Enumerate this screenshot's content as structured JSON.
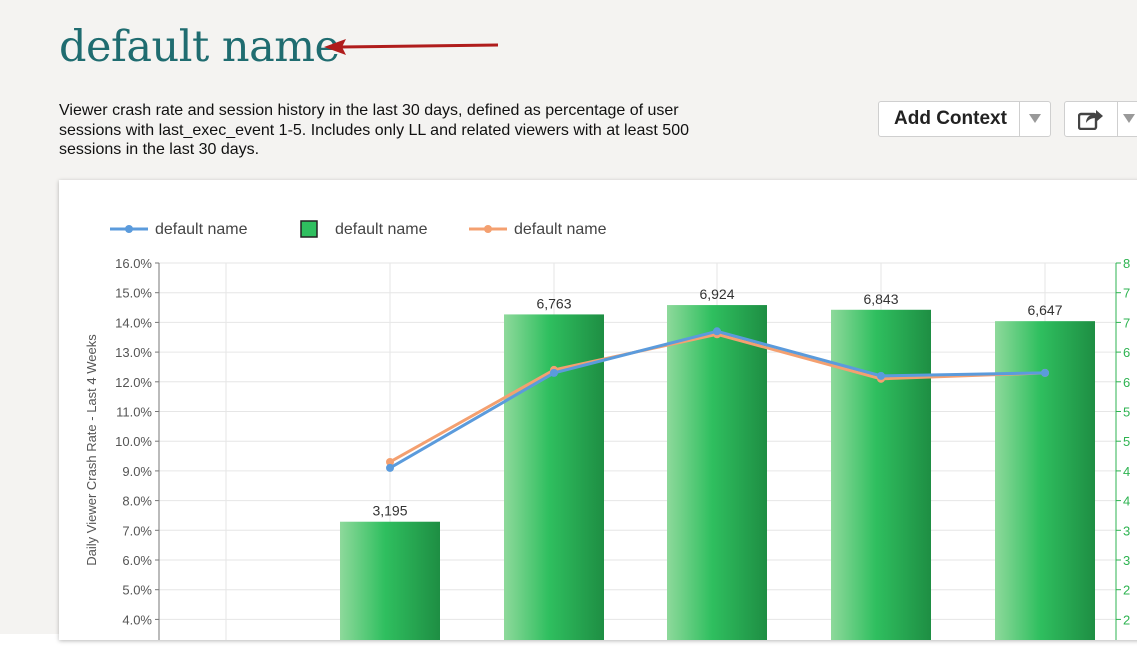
{
  "page": {
    "title": "default name",
    "description": "Viewer crash rate and session history in the last 30 days, defined as percentage of user sessions with last_exec_event 1-5. Includes only LL and related viewers with at least 500 sessions in the last 30 days."
  },
  "toolbar": {
    "add_context_label": "Add Context"
  },
  "icons": {
    "caret": "caret-down-icon",
    "share": "share-icon",
    "annotation": "red-arrow-icon"
  },
  "colors": {
    "title": "#1f6c70",
    "bars": "#2fbf5f",
    "line_blue": "#5b9bdc",
    "line_orange": "#f4a070",
    "right_axis": "#2db350",
    "annotation_arrow": "#b01c1c"
  },
  "chart_data": {
    "type": "bar",
    "legend": [
      {
        "name": "default name",
        "kind": "line",
        "color": "#5b9bdc"
      },
      {
        "name": "default name",
        "kind": "bar",
        "color": "#2fbf5f"
      },
      {
        "name": "default name",
        "kind": "line",
        "color": "#f4a070"
      }
    ],
    "ylabel": "Daily Viewer Crash Rate - Last 4 Weeks",
    "ylim": [
      4,
      16
    ],
    "yticks": [
      "16.0%",
      "15.0%",
      "14.0%",
      "13.0%",
      "12.0%",
      "11.0%",
      "10.0%",
      "9.0%",
      "8.0%",
      "7.0%",
      "6.0%",
      "5.0%",
      "4.0%"
    ],
    "right_ticks": [
      "8",
      "7",
      "7",
      "6",
      "6",
      "5",
      "5",
      "4",
      "4",
      "3",
      "3",
      "2",
      "2"
    ],
    "bars": {
      "name": "default name",
      "values": [
        null,
        3195,
        6763,
        6924,
        6843,
        6647
      ],
      "labels": [
        "",
        "3,195",
        "6,763",
        "6,924",
        "6,843",
        "6,647"
      ]
    },
    "series": [
      {
        "name": "default name",
        "values": [
          null,
          9.1,
          12.3,
          13.7,
          12.2,
          12.3
        ]
      },
      {
        "name": "default name",
        "values": [
          null,
          9.3,
          12.4,
          13.6,
          12.1,
          12.3
        ]
      }
    ],
    "grid": true,
    "legend_position": "top-left"
  }
}
